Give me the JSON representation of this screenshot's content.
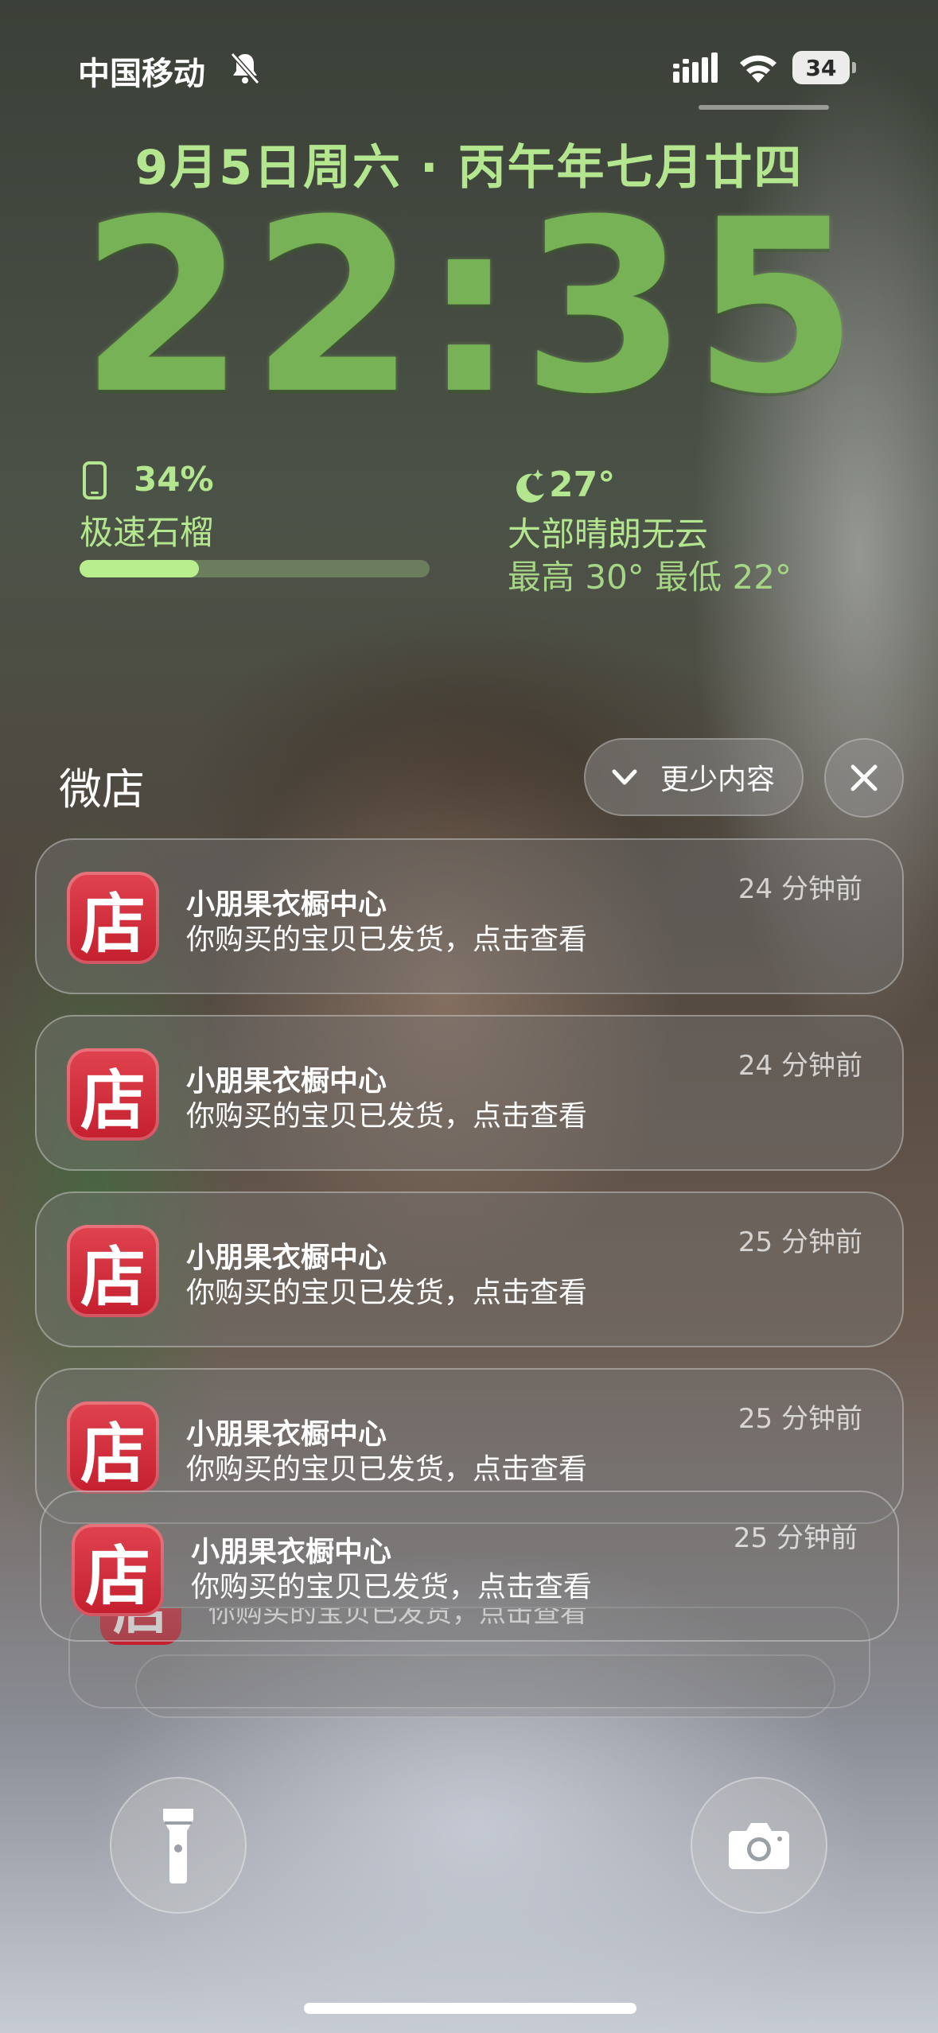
{
  "status_bar": {
    "carrier": "中国移动",
    "battery_level": "34",
    "icons": [
      "bell-off-icon",
      "signal-icon",
      "wifi-icon",
      "battery-icon"
    ]
  },
  "lock_screen": {
    "date": "9月5日周六 · 丙午年七月廿四",
    "time": "22:35"
  },
  "widgets": {
    "battery": {
      "percent": "34%",
      "device": "极速石榴",
      "level": 0.34
    },
    "weather": {
      "temperature": "27°",
      "condition": "大部晴朗无云",
      "range": "最高 30° 最低 22°"
    }
  },
  "notification_group": {
    "app_name": "微店",
    "show_less_label": "更少内容",
    "app_icon_glyph": "店",
    "notifications": [
      {
        "title": "小朋果衣橱中心",
        "body": "你购买的宝贝已发货，点击查看",
        "time": "24 分钟前"
      },
      {
        "title": "小朋果衣橱中心",
        "body": "你购买的宝贝已发货，点击查看",
        "time": "24 分钟前"
      },
      {
        "title": "小朋果衣橱中心",
        "body": "你购买的宝贝已发货，点击查看",
        "time": "25 分钟前"
      },
      {
        "title": "小朋果衣橱中心",
        "body": "你购买的宝贝已发货，点击查看",
        "time": "25 分钟前"
      },
      {
        "title": "小朋果衣橱中心",
        "body": "你购买的宝贝已发货，点击查看",
        "time": "25 分钟前"
      }
    ],
    "stacked_peek_text": "你购买的宝贝已发货，点击查看"
  },
  "bottom_controls": {
    "left": "flashlight-icon",
    "right": "camera-icon"
  },
  "colors": {
    "widget_green": "#b4e68f",
    "clock_green": "#77b256",
    "app_icon_red": "#c51f2f"
  }
}
